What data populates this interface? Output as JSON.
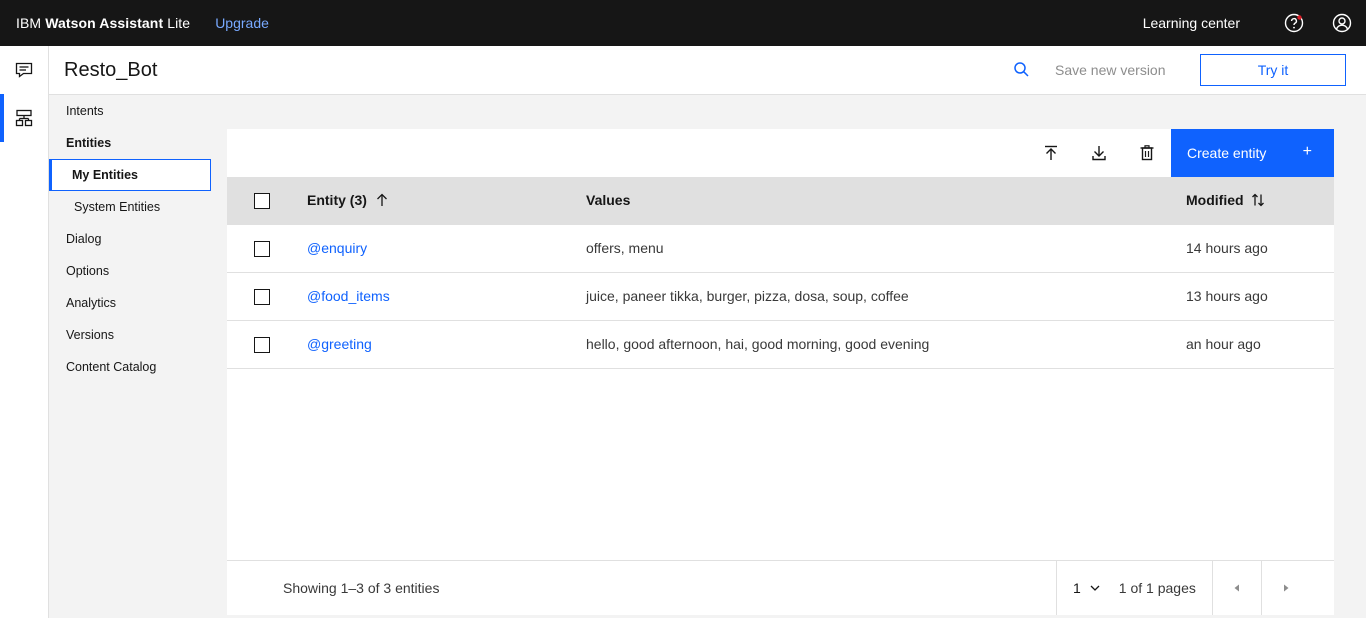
{
  "topbar": {
    "brand_prefix": "IBM ",
    "brand_bold": "Watson Assistant",
    "brand_suffix": " Lite",
    "upgrade_label": "Upgrade",
    "learning_center_label": "Learning center",
    "icons": [
      "help-icon",
      "user-avatar-icon"
    ]
  },
  "rail": {
    "items": [
      {
        "icon": "chat-icon",
        "active": false
      },
      {
        "icon": "skills-icon",
        "active": true
      }
    ]
  },
  "header": {
    "title": "Resto_Bot",
    "save_label": "Save new version",
    "try_label": "Try it"
  },
  "sidenav": {
    "items": [
      {
        "label": "Intents"
      },
      {
        "label": "Entities"
      },
      {
        "label": "My Entities"
      },
      {
        "label": "System Entities"
      },
      {
        "label": "Dialog"
      },
      {
        "label": "Options"
      },
      {
        "label": "Analytics"
      },
      {
        "label": "Versions"
      },
      {
        "label": "Content Catalog"
      }
    ]
  },
  "toolbar": {
    "create_label": "Create entity",
    "create_plus": "+"
  },
  "table": {
    "columns": {
      "entity": "Entity (3)",
      "values": "Values",
      "modified": "Modified"
    },
    "rows": [
      {
        "entity": "@enquiry",
        "values": "offers, menu",
        "modified": "14 hours ago"
      },
      {
        "entity": "@food_items",
        "values": "juice, paneer tikka, burger, pizza, dosa, soup, coffee",
        "modified": "13 hours ago"
      },
      {
        "entity": "@greeting",
        "values": "hello, good afternoon, hai, good morning, good evening",
        "modified": "an hour ago"
      }
    ]
  },
  "footer": {
    "showing": "Showing 1–3 of 3 entities",
    "page": "1",
    "page_of": "1 of 1 pages"
  },
  "colors": {
    "topbar": "#161616",
    "accent": "#0f62fe",
    "link": "#0f62fe",
    "upgrade": "#78a9ff"
  }
}
